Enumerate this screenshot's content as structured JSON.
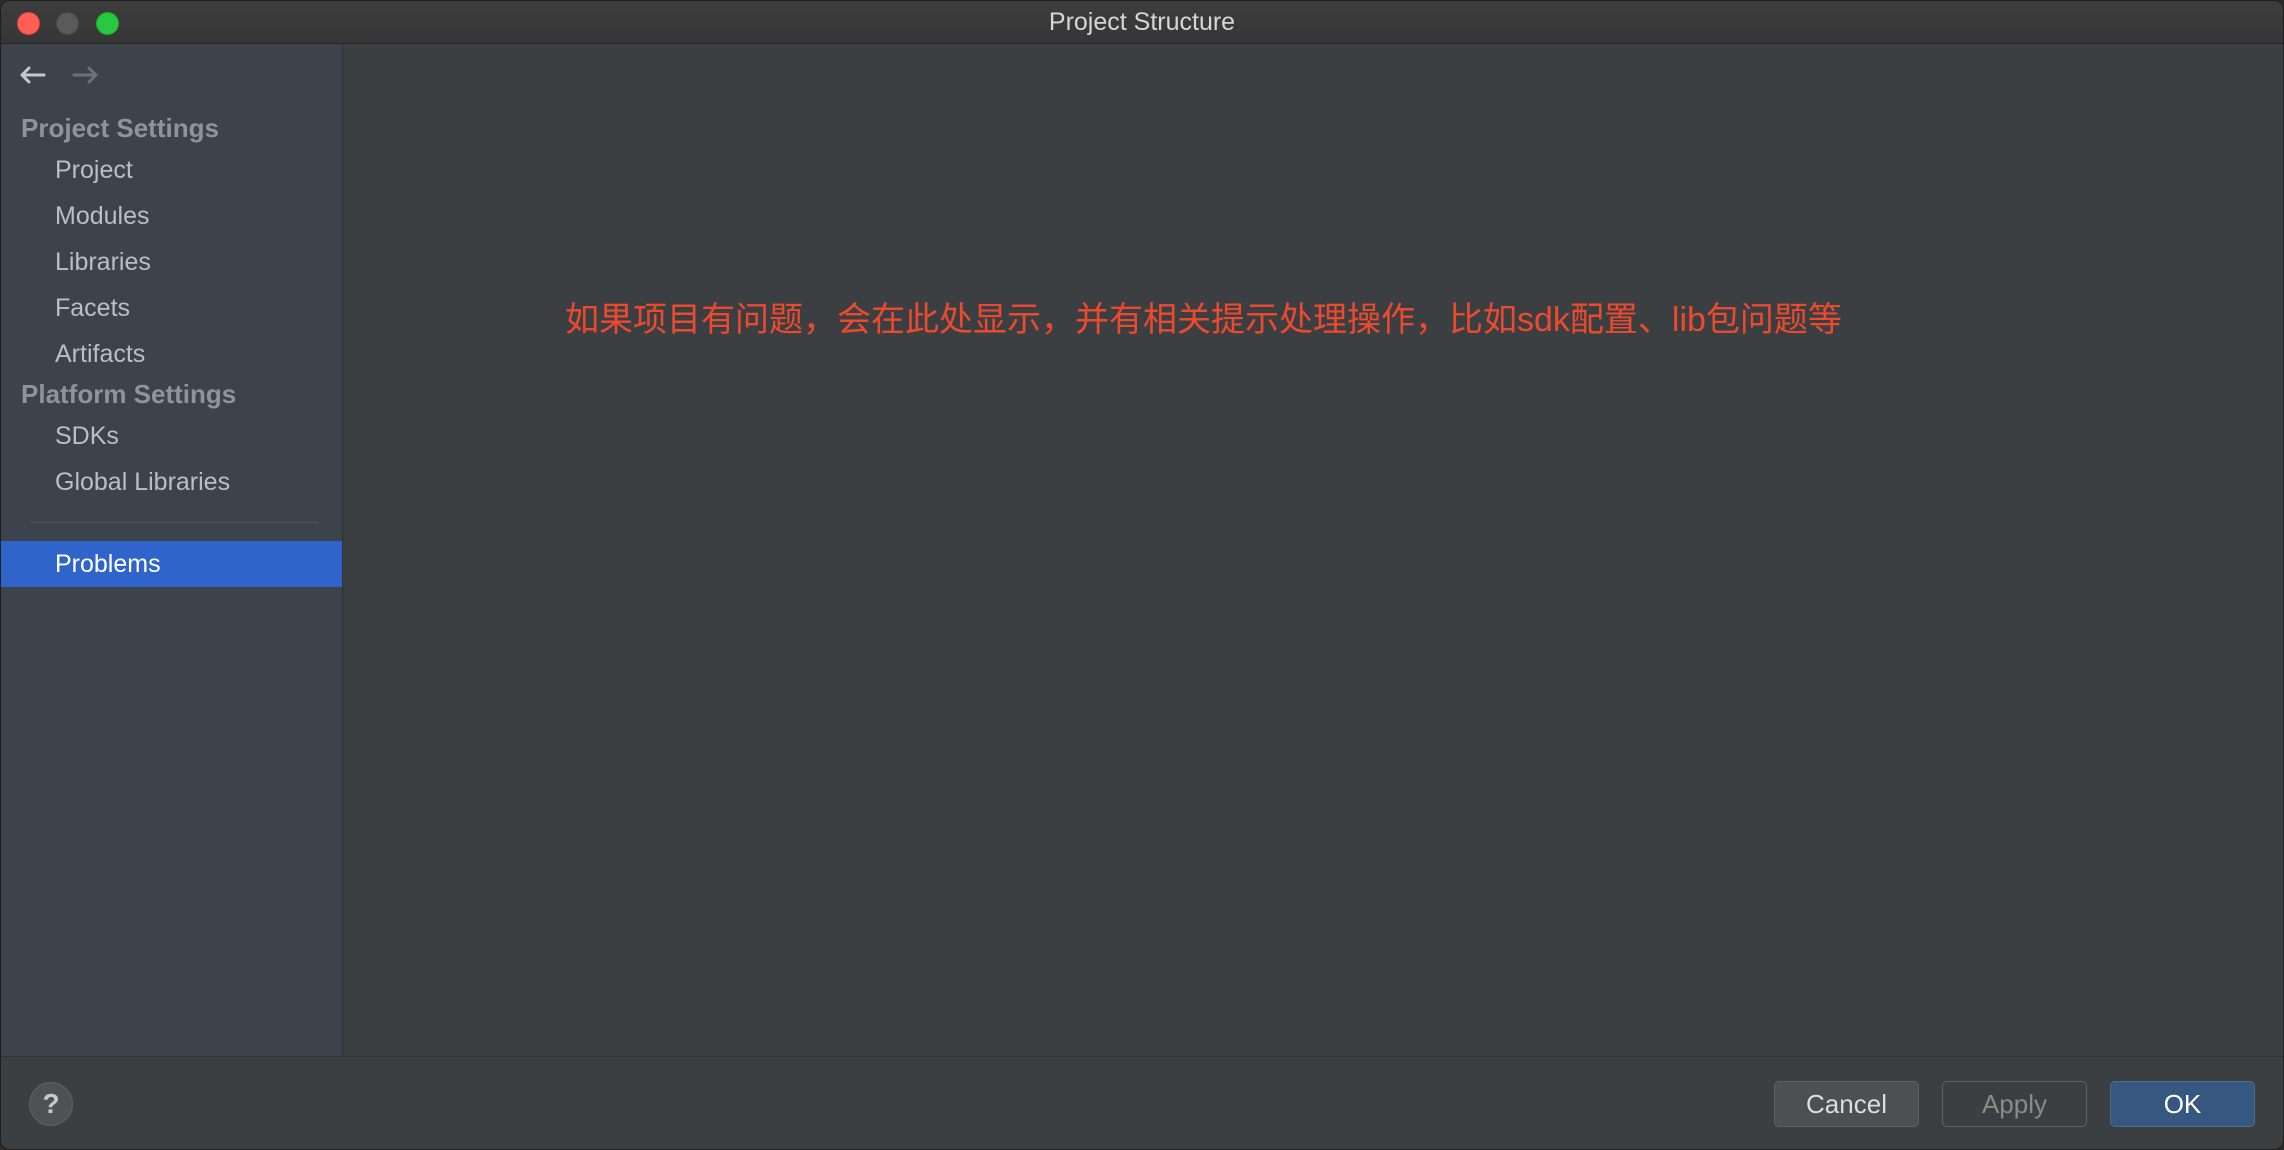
{
  "window": {
    "title": "Project Structure"
  },
  "sidebar": {
    "sections": [
      {
        "header": "Project Settings",
        "items": [
          "Project",
          "Modules",
          "Libraries",
          "Facets",
          "Artifacts"
        ]
      },
      {
        "header": "Platform Settings",
        "items": [
          "SDKs",
          "Global Libraries"
        ]
      }
    ],
    "selected_item": "Problems"
  },
  "main": {
    "note": "如果项目有问题，会在此处显示，并有相关提示处理操作，比如sdk配置、lib包问题等"
  },
  "footer": {
    "help_label": "?",
    "cancel_label": "Cancel",
    "apply_label": "Apply",
    "ok_label": "OK"
  },
  "colors": {
    "sidebar_bg": "#3d434d",
    "selected_bg": "#2f65ca",
    "main_bg": "#3c3f41",
    "note_color": "#ec4a2e",
    "ok_button_bg": "#365880"
  },
  "icons": {
    "back": "arrow-left-icon",
    "forward": "arrow-right-icon",
    "help": "question-icon"
  }
}
